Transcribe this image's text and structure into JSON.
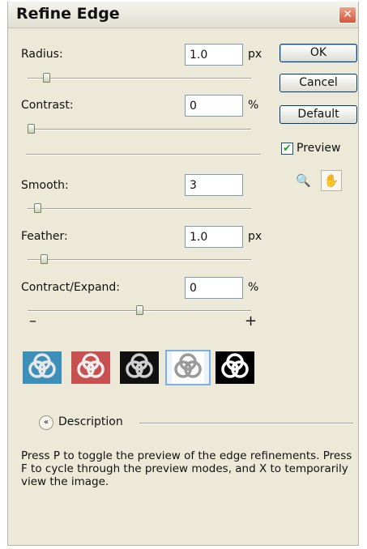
{
  "dialog": {
    "title": "Refine Edge",
    "close_glyph": "✕"
  },
  "fields": {
    "radius": {
      "label": "Radius:",
      "value": "1.0",
      "unit": "px",
      "slider": 0.07
    },
    "contrast": {
      "label": "Contrast:",
      "value": "0",
      "unit": "%",
      "slider": 0.0
    },
    "smooth": {
      "label": "Smooth:",
      "value": "3",
      "unit": "",
      "slider": 0.03
    },
    "feather": {
      "label": "Feather:",
      "value": "1.0",
      "unit": "px",
      "slider": 0.06
    },
    "contract_expand": {
      "label": "Contract/Expand:",
      "value": "0",
      "unit": "%",
      "slider": 0.5
    }
  },
  "contract_expand_ends": {
    "minus": "–",
    "plus": "+"
  },
  "buttons": {
    "ok": "OK",
    "cancel": "Cancel",
    "default": "Default"
  },
  "preview": {
    "label": "Preview",
    "checked": true,
    "check_glyph": "✔"
  },
  "tools": {
    "zoom_icon": "magnifier-icon",
    "hand_icon": "hand-icon",
    "zoom_glyph": "🔍",
    "hand_glyph": "✋"
  },
  "preview_modes": [
    {
      "name": "standard",
      "bg": "#3c8fb8"
    },
    {
      "name": "quick-mask",
      "bg": "#c85050"
    },
    {
      "name": "on-black",
      "bg": "#101010"
    },
    {
      "name": "on-white",
      "bg": "#ffffff"
    },
    {
      "name": "mask",
      "bg": "#000000"
    }
  ],
  "selected_preview_mode": 3,
  "description": {
    "toggle_glyph": "«",
    "label": "Description",
    "text": "Press P to toggle the preview of the edge refinements. Press F to cycle through the preview modes, and X to temporarily view the image."
  }
}
